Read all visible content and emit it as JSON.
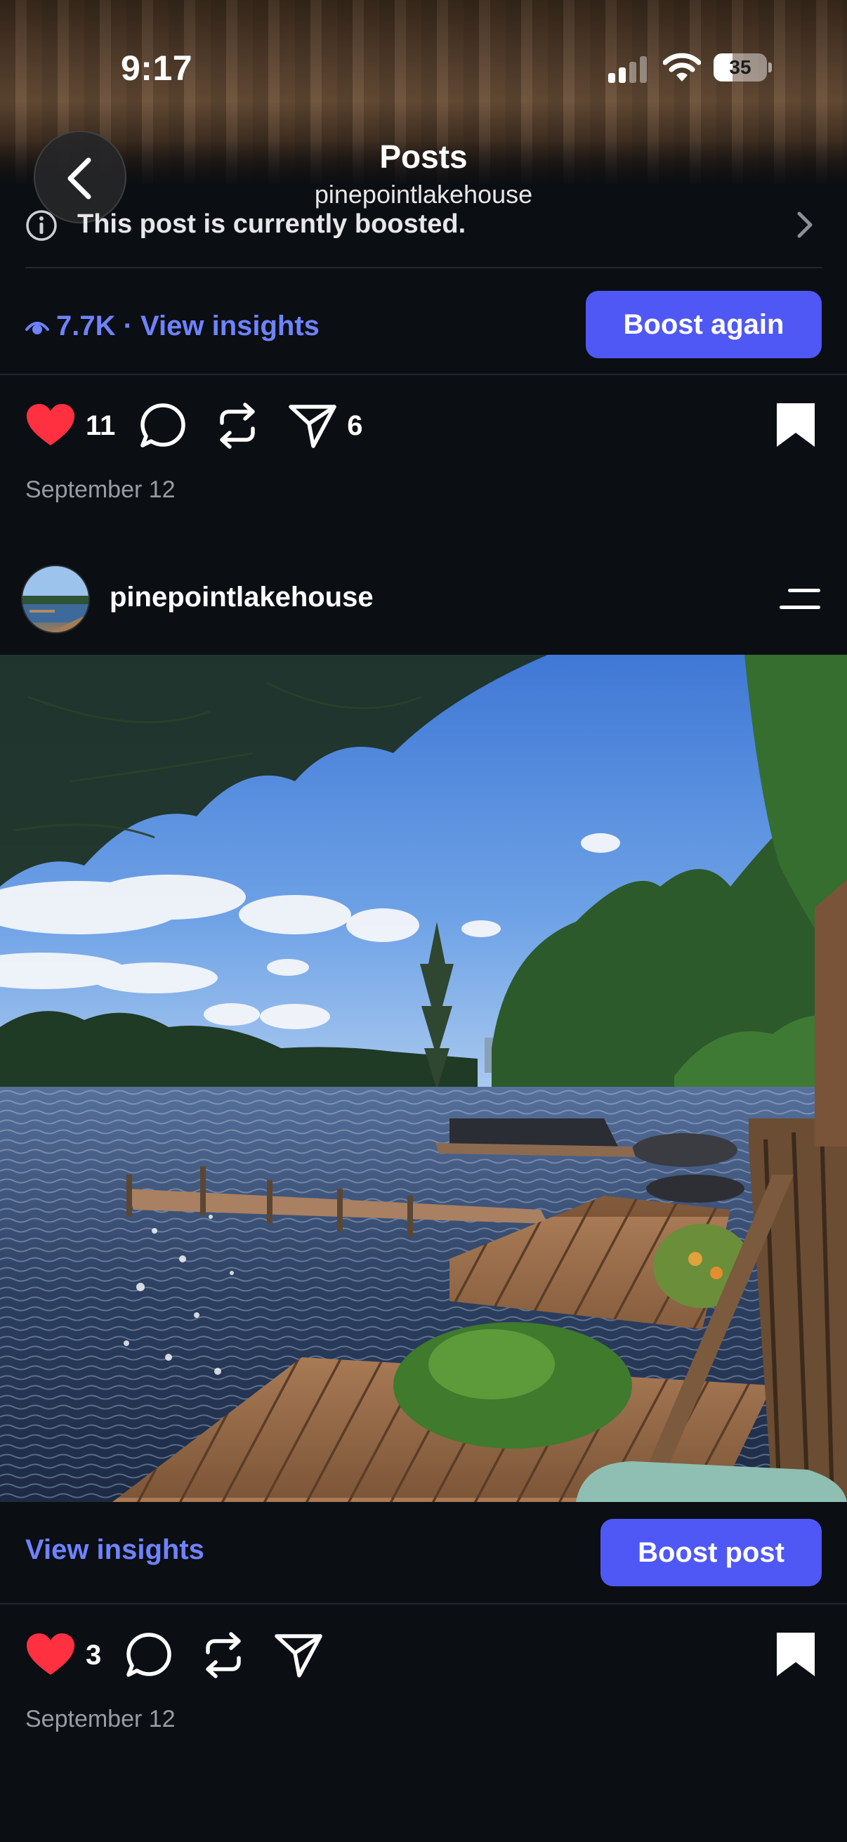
{
  "status_bar": {
    "time": "9:17",
    "battery": "35",
    "battery_level": 0.35
  },
  "header": {
    "title": "Posts",
    "subtitle": "pinepointlakehouse"
  },
  "banner": {
    "text": "This post is currently boosted."
  },
  "post1": {
    "insights_label": "7.7K · View insights",
    "boost_label": "Boost again",
    "likes": "11",
    "shares": "6",
    "date": "September 12"
  },
  "post2": {
    "username": "pinepointlakehouse",
    "insights_label": "View insights",
    "boost_label": "Boost post",
    "likes": "3",
    "date": "September 12"
  },
  "colors": {
    "accent": "#4f58f5",
    "link": "#6e83ff",
    "heart": "#ff3040",
    "background": "#0b0e13"
  }
}
